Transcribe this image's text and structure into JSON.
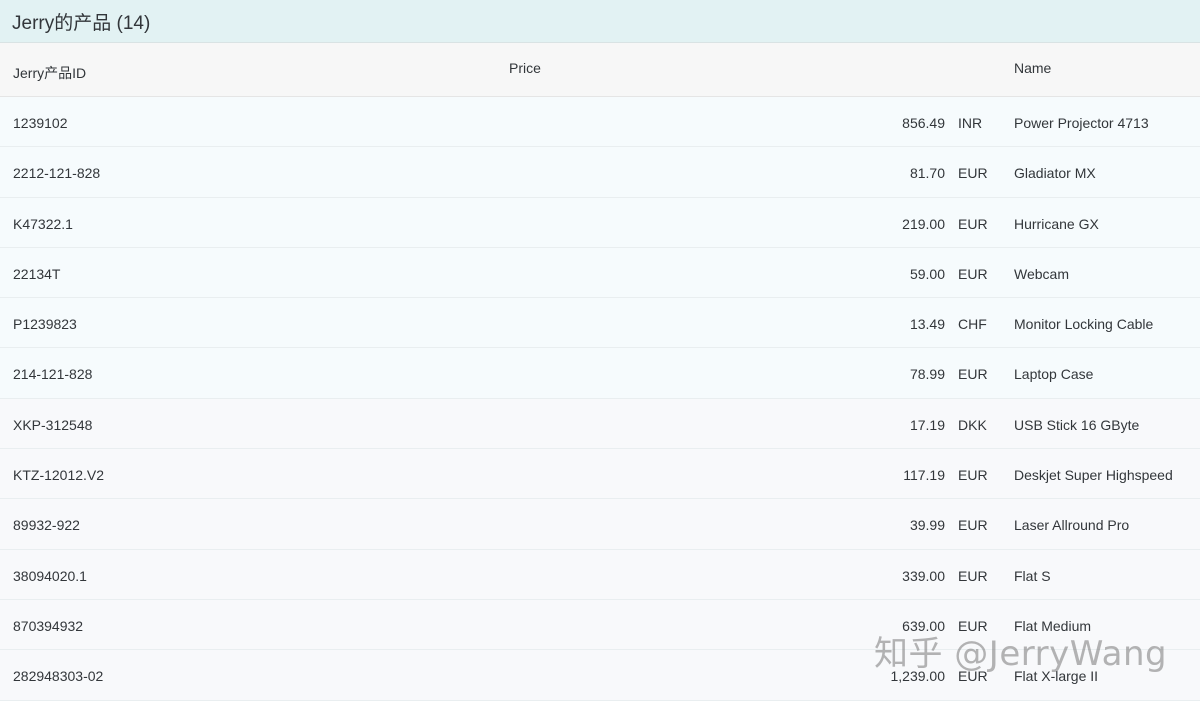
{
  "title": "Jerry的产品 (14)",
  "columns": {
    "id": "Jerry产品ID",
    "price": "Price",
    "name": "Name"
  },
  "rows": [
    {
      "id": "1239102",
      "amount": "856.49",
      "currency": "INR",
      "name": "Power Projector 4713"
    },
    {
      "id": "2212-121-828",
      "amount": "81.70",
      "currency": "EUR",
      "name": "Gladiator MX"
    },
    {
      "id": "K47322.1",
      "amount": "219.00",
      "currency": "EUR",
      "name": "Hurricane GX"
    },
    {
      "id": "22134T",
      "amount": "59.00",
      "currency": "EUR",
      "name": "Webcam"
    },
    {
      "id": "P1239823",
      "amount": "13.49",
      "currency": "CHF",
      "name": "Monitor Locking Cable"
    },
    {
      "id": "214-121-828",
      "amount": "78.99",
      "currency": "EUR",
      "name": "Laptop Case"
    },
    {
      "id": "XKP-312548",
      "amount": "17.19",
      "currency": "DKK",
      "name": "USB Stick 16 GByte"
    },
    {
      "id": "KTZ-12012.V2",
      "amount": "117.19",
      "currency": "EUR",
      "name": "Deskjet Super Highspeed"
    },
    {
      "id": "89932-922",
      "amount": "39.99",
      "currency": "EUR",
      "name": "Laser Allround Pro"
    },
    {
      "id": "38094020.1",
      "amount": "339.00",
      "currency": "EUR",
      "name": "Flat S"
    },
    {
      "id": "870394932",
      "amount": "639.00",
      "currency": "EUR",
      "name": "Flat Medium"
    },
    {
      "id": "282948303-02",
      "amount": "1,239.00",
      "currency": "EUR",
      "name": "Flat X-large II"
    }
  ],
  "watermark": "知乎 @JerryWang"
}
